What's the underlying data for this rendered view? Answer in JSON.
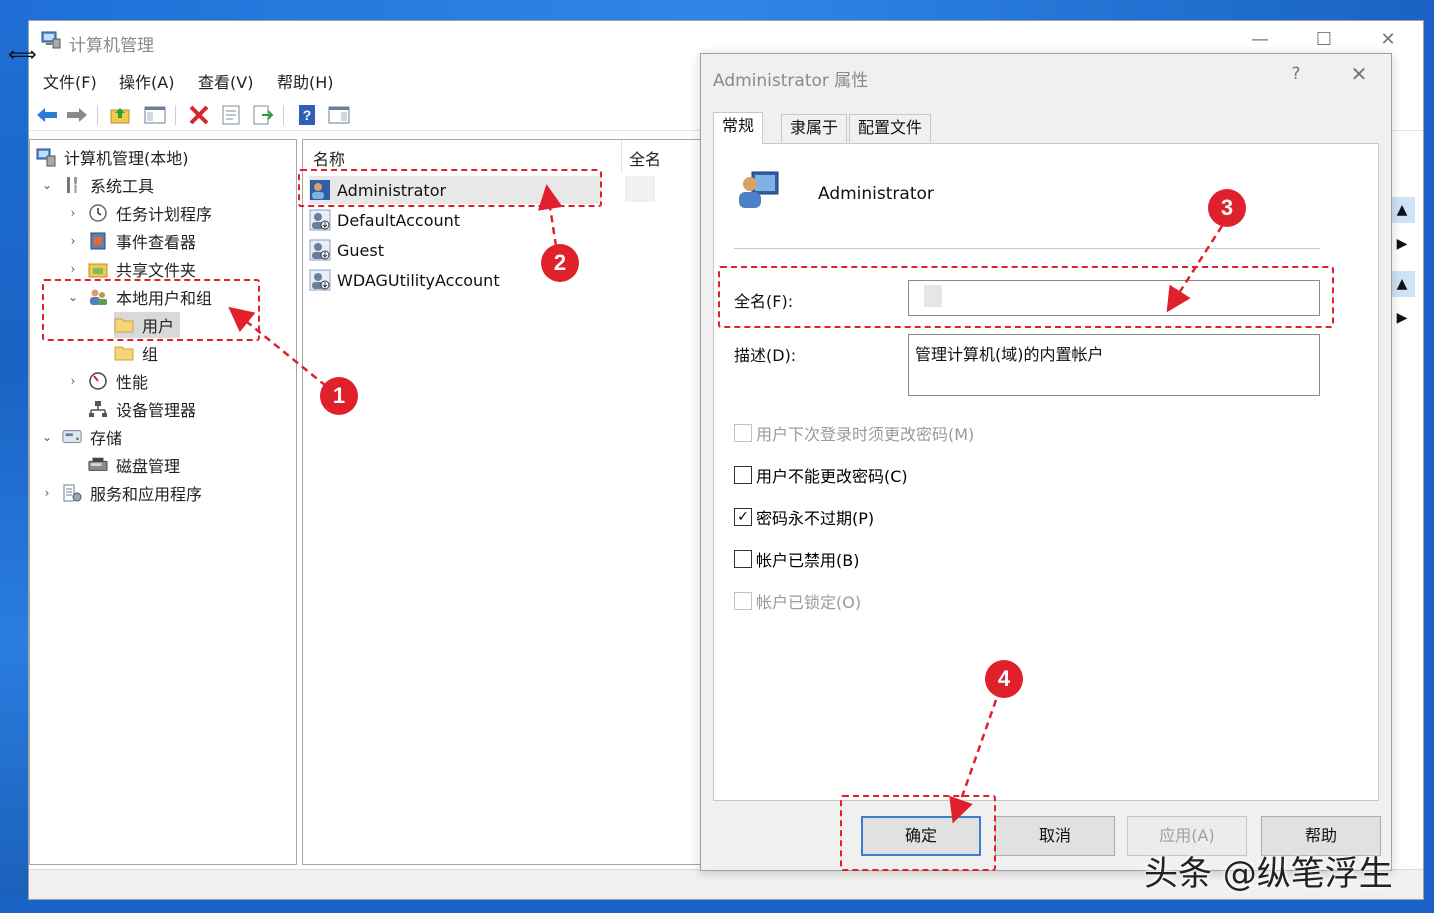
{
  "window": {
    "title": "计算机管理",
    "controls": {
      "minimize": "—",
      "maximize": "☐",
      "close": "✕"
    }
  },
  "menu": [
    "文件(F)",
    "操作(A)",
    "查看(V)",
    "帮助(H)"
  ],
  "tree": {
    "root": "计算机管理(本地)",
    "system_tools": "系统工具",
    "task_scheduler": "任务计划程序",
    "event_viewer": "事件查看器",
    "shared_folders": "共享文件夹",
    "local_users_groups": "本地用户和组",
    "users": "用户",
    "groups": "组",
    "performance": "性能",
    "device_manager": "设备管理器",
    "storage": "存储",
    "disk_management": "磁盘管理",
    "services_apps": "服务和应用程序"
  },
  "list": {
    "col_name": "名称",
    "col_fullname": "全名",
    "rows": [
      "Administrator",
      "DefaultAccount",
      "Guest",
      "WDAGUtilityAccount"
    ]
  },
  "dialog": {
    "title": "Administrator 属性",
    "help": "?",
    "close": "✕",
    "tabs": [
      "常规",
      "隶属于",
      "配置文件"
    ],
    "username": "Administrator",
    "fullname_label": "全名(F):",
    "fullname_value": "",
    "description_label": "描述(D):",
    "description_value": "管理计算机(域)的内置帐户",
    "checkboxes": [
      {
        "label": "用户下次登录时须更改密码(M)",
        "checked": false,
        "disabled": true
      },
      {
        "label": "用户不能更改密码(C)",
        "checked": false,
        "disabled": false
      },
      {
        "label": "密码永不过期(P)",
        "checked": true,
        "disabled": false
      },
      {
        "label": "帐户已禁用(B)",
        "checked": false,
        "disabled": false
      },
      {
        "label": "帐户已锁定(O)",
        "checked": false,
        "disabled": true
      }
    ],
    "buttons": {
      "ok": "确定",
      "cancel": "取消",
      "apply": "应用(A)",
      "help": "帮助"
    }
  },
  "annotations": [
    "1",
    "2",
    "3",
    "4"
  ],
  "annotation_color": "#e0202b",
  "watermark": "头条 @纵笔浮生"
}
